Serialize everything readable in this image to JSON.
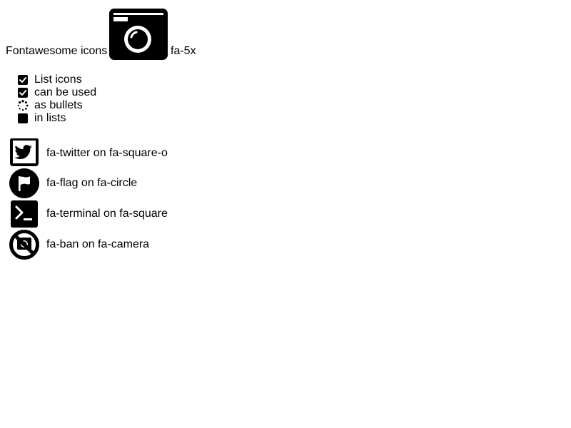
{
  "header": {
    "lead_text": "Fontawesome icons",
    "icon": "camera-icon",
    "trail_text": "fa-5x"
  },
  "list": {
    "items": [
      {
        "label": "List icons",
        "icon": "check-square-icon"
      },
      {
        "label": "can be used",
        "icon": "check-square-icon"
      },
      {
        "label": "as bullets",
        "icon": "spinner-icon"
      },
      {
        "label": "in lists",
        "icon": "square-icon"
      }
    ]
  },
  "stacked": {
    "items": [
      {
        "label": "fa-twitter on fa-square-o",
        "icon": "twitter-on-square-o-icon"
      },
      {
        "label": "fa-flag on fa-circle",
        "icon": "flag-on-circle-icon"
      },
      {
        "label": "fa-terminal on fa-square",
        "icon": "terminal-on-square-icon"
      },
      {
        "label": "fa-ban on fa-camera",
        "icon": "ban-on-camera-icon"
      }
    ]
  }
}
